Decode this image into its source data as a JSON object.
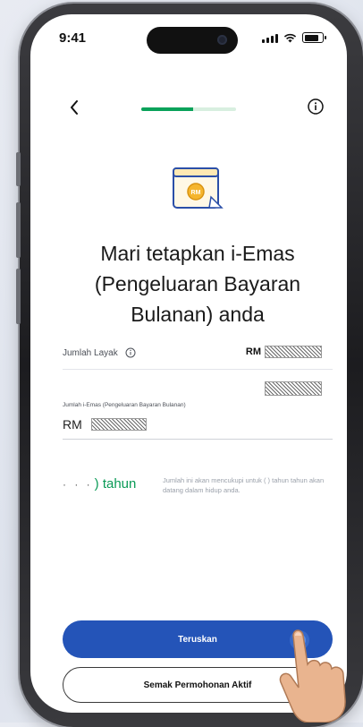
{
  "status_bar": {
    "time": "9:41"
  },
  "header": {
    "back_icon": "chevron-left-icon",
    "info_icon": "info-icon",
    "progress": 0.55
  },
  "title": "Mari tetapkan i-Emas (Pengeluaran Bayaran Bulanan) anda",
  "eligible": {
    "label": "Jumlah Layak",
    "currency": "RM"
  },
  "field": {
    "label": "Jumlah i-Emas (Pengeluaran Bayaran Bulanan)",
    "currency": "RM"
  },
  "duration": {
    "value_suffix": ") tahun",
    "description": "Jumlah ini akan mencukupi untuk ( ) tahun tahun akan datang dalam hidup anda."
  },
  "buttons": {
    "primary": "Teruskan",
    "secondary": "Semak Permohonan Aktif"
  },
  "colors": {
    "accent_green": "#0aa25a",
    "primary_blue": "#2454b8"
  }
}
